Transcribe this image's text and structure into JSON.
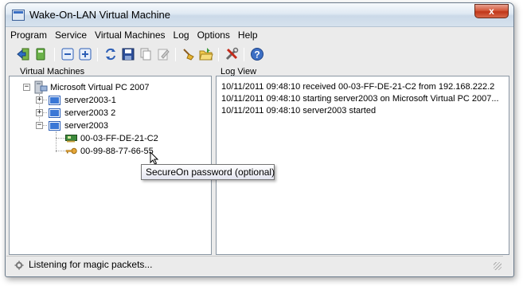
{
  "window": {
    "title": "Wake-On-LAN Virtual Machine",
    "close_glyph": "x"
  },
  "menu": [
    "Program",
    "Service",
    "Virtual Machines",
    "Log",
    "Options",
    "Help"
  ],
  "toolbar": {
    "buttons": [
      "exit-icon",
      "save-green-icon",
      "remove-icon",
      "add-icon",
      "refresh-icon",
      "save-icon",
      "copy-icon",
      "edit-icon",
      "clean-icon",
      "open-folder-icon",
      "tools-icon",
      "help-icon"
    ]
  },
  "panels": {
    "vm_label": "Virtual Machines",
    "log_label": "Log View"
  },
  "tree": {
    "root": "Microsoft Virtual PC 2007",
    "vms": [
      {
        "name": "server2003-1",
        "expanded": false
      },
      {
        "name": "server2003 2",
        "expanded": false
      },
      {
        "name": "server2003",
        "expanded": true
      }
    ],
    "nic_mac": "00-03-FF-DE-21-C2",
    "secureon": "00-99-88-77-66-55"
  },
  "log": [
    "10/11/2011 09:48:10  received 00-03-FF-DE-21-C2 from 192.168.222.2",
    "10/11/2011 09:48:10  starting server2003 on Microsoft Virtual PC 2007...",
    "10/11/2011 09:48:10  server2003 started"
  ],
  "tooltip": "SecureOn password (optional)",
  "status": "Listening for magic packets...",
  "colors": {
    "accent_blue": "#2d5fb6",
    "window_bg": "#ebebeb"
  }
}
